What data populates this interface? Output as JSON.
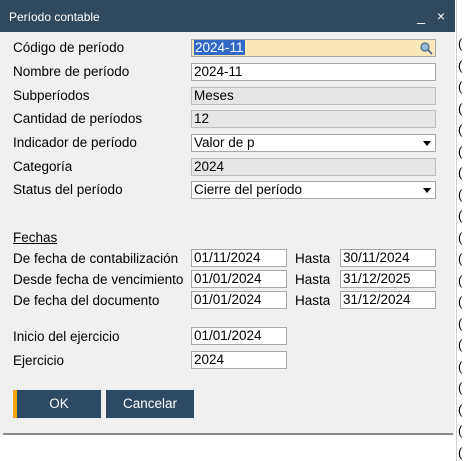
{
  "window": {
    "title": "Período contable",
    "minimize_glyph": "_",
    "close_glyph": "×"
  },
  "form": {
    "codigo": {
      "label": "Código de período",
      "value": "2024-11",
      "icon": "lookup-icon"
    },
    "nombre": {
      "label": "Nombre de período",
      "value": "2024-11"
    },
    "subperiodos": {
      "label": "Subperíodos",
      "value": "Meses"
    },
    "cantidad": {
      "label": "Cantidad de períodos",
      "value": "12"
    },
    "indicador": {
      "label": "Indicador de período",
      "value": "Valor de p"
    },
    "categoria": {
      "label": "Categoría",
      "value": "2024"
    },
    "status": {
      "label": "Status del período",
      "value": "Cierre del período"
    }
  },
  "fechas": {
    "heading": "Fechas",
    "hasta_label": "Hasta",
    "rows": [
      {
        "label": "De fecha de contabilización",
        "from": "01/11/2024",
        "to": "30/11/2024"
      },
      {
        "label": "Desde fecha de vencimiento",
        "from": "01/01/2024",
        "to": "31/12/2025"
      },
      {
        "label": "De fecha del documento",
        "from": "01/01/2024",
        "to": "31/12/2024"
      }
    ]
  },
  "ejercicio": {
    "inicio": {
      "label": "Inicio del ejercicio",
      "value": "01/01/2024"
    },
    "anio": {
      "label": "Ejercicio",
      "value": "2024"
    }
  },
  "buttons": {
    "ok": "OK",
    "cancel": "Cancelar"
  },
  "colors": {
    "titlebar": "#2f4a5f",
    "button": "#2c4a64",
    "accent": "#f0a800",
    "selection": "#3169c6",
    "focus_field": "#fbe8b8"
  },
  "edge_marks": [
    "(",
    "(",
    "(",
    "(",
    "(",
    "(",
    "(",
    "(",
    "(",
    "(",
    "(",
    "(",
    "(",
    "(",
    "(",
    "(",
    "(",
    "(",
    "(",
    "("
  ]
}
